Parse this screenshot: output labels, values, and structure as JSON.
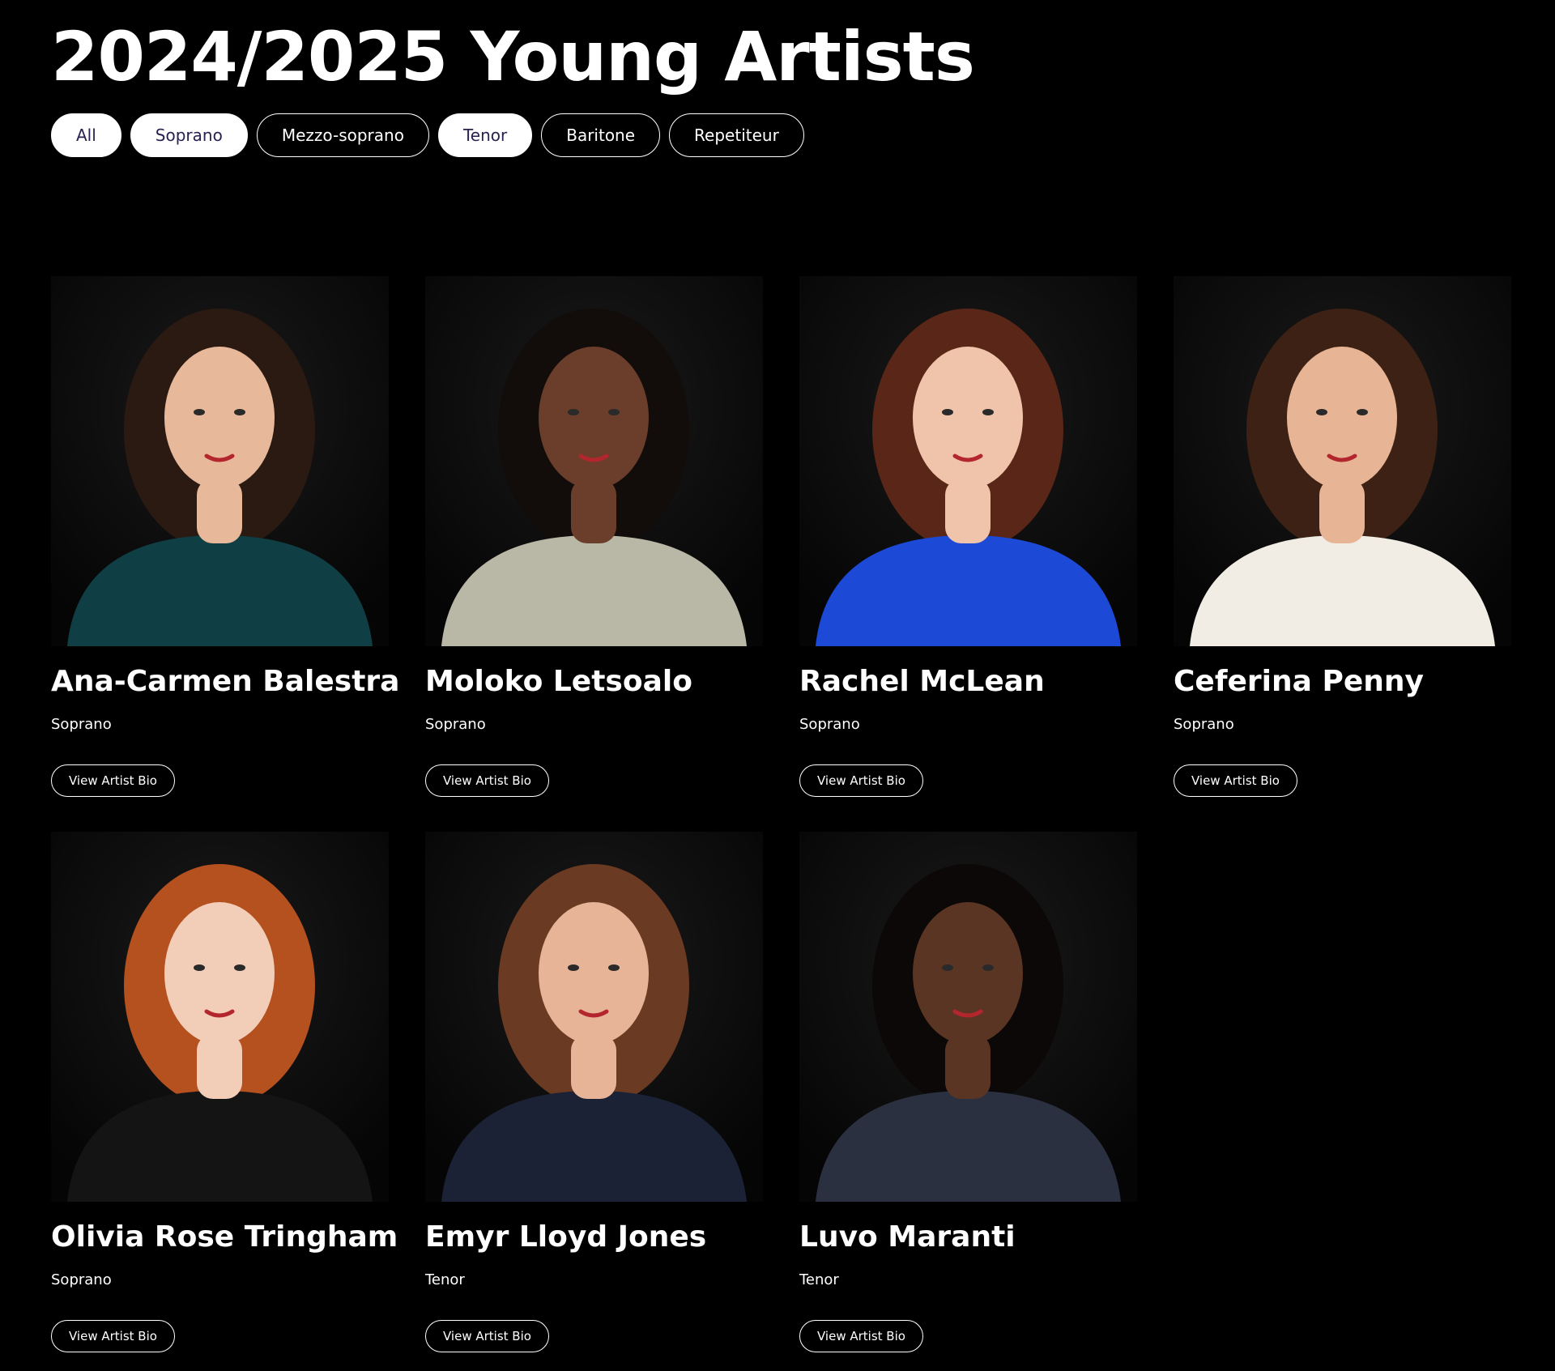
{
  "page": {
    "title": "2024/2025 Young Artists"
  },
  "filters": [
    {
      "label": "All",
      "active": true
    },
    {
      "label": "Soprano",
      "active": true
    },
    {
      "label": "Mezzo-soprano",
      "active": false
    },
    {
      "label": "Tenor",
      "active": true
    },
    {
      "label": "Baritone",
      "active": false
    },
    {
      "label": "Repetiteur",
      "active": false
    }
  ],
  "artists": [
    {
      "name": "Ana-Carmen Balestra",
      "voice": "Soprano",
      "button": "View Artist Bio",
      "hair": "#2b1a12",
      "outfit": "#0f3f45",
      "skin": "#e8b89a"
    },
    {
      "name": "Moloko Letsoalo",
      "voice": "Soprano",
      "button": "View Artist Bio",
      "hair": "#120c0a",
      "outfit": "#b9b7a5",
      "skin": "#6a3e2b"
    },
    {
      "name": "Rachel McLean",
      "voice": "Soprano",
      "button": "View Artist Bio",
      "hair": "#5a2617",
      "outfit": "#1c49d6",
      "skin": "#f0c4ab"
    },
    {
      "name": "Ceferina Penny",
      "voice": "Soprano",
      "button": "View Artist Bio",
      "hair": "#3d2114",
      "outfit": "#f1ede4",
      "skin": "#e7b596"
    },
    {
      "name": "Olivia Rose Tringham",
      "voice": "Soprano",
      "button": "View Artist Bio",
      "hair": "#b5501f",
      "outfit": "#141414",
      "skin": "#f2cdb8"
    },
    {
      "name": "Emyr Lloyd Jones",
      "voice": "Tenor",
      "button": "View Artist Bio",
      "hair": "#6a3a22",
      "outfit": "#1b2235",
      "skin": "#e8b497"
    },
    {
      "name": "Luvo Maranti",
      "voice": "Tenor",
      "button": "View Artist Bio",
      "hair": "#0b0807",
      "outfit": "#2b3040",
      "skin": "#5b3524"
    }
  ]
}
